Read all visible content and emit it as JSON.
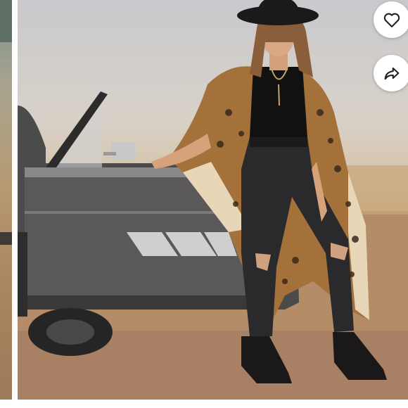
{
  "gallery": {
    "like_icon": "heart-outline-icon",
    "share_icon": "share-arrow-icon",
    "photo_subject": "woman-in-leopard-kimono-leaning-on-vintage-car"
  },
  "colors": {
    "fab_background": "#ffffff",
    "icon_stroke": "#222222"
  }
}
